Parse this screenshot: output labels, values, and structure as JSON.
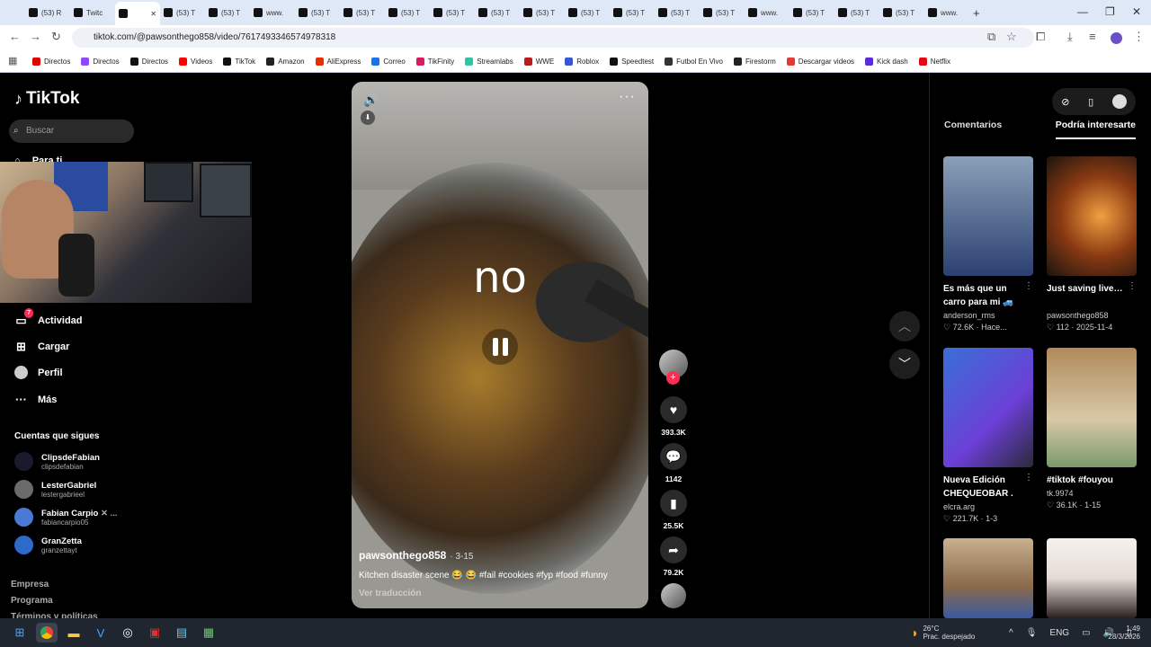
{
  "browser": {
    "tabs": [
      {
        "label": "(53) R",
        "active": false
      },
      {
        "label": "Twitc",
        "active": false
      },
      {
        "label": "",
        "active": true
      },
      {
        "label": "(53) T",
        "active": false
      },
      {
        "label": "(53) T",
        "active": false
      },
      {
        "label": "www.",
        "active": false
      },
      {
        "label": "(53) T",
        "active": false
      },
      {
        "label": "(53) T",
        "active": false
      },
      {
        "label": "(53) T",
        "active": false
      },
      {
        "label": "(53) T",
        "active": false
      },
      {
        "label": "(53) T",
        "active": false
      },
      {
        "label": "(53) T",
        "active": false
      },
      {
        "label": "(53) T",
        "active": false
      },
      {
        "label": "(53) T",
        "active": false
      },
      {
        "label": "(53) T",
        "active": false
      },
      {
        "label": "(53) T",
        "active": false
      },
      {
        "label": "www.",
        "active": false
      },
      {
        "label": "(53) T",
        "active": false
      },
      {
        "label": "(53) T",
        "active": false
      },
      {
        "label": "(53) T",
        "active": false
      },
      {
        "label": "www.",
        "active": false
      }
    ],
    "new_tab": "+",
    "url": "tiktok.com/@pawsonthego858/video/7617493346574978318",
    "bookmarks": [
      {
        "label": "Directos",
        "color": "#e00000"
      },
      {
        "label": "Directos",
        "color": "#9146ff"
      },
      {
        "label": "Directos",
        "color": "#111111"
      },
      {
        "label": "Videos",
        "color": "#ff0000"
      },
      {
        "label": "TikTok",
        "color": "#111111"
      },
      {
        "label": "Amazon",
        "color": "#222222"
      },
      {
        "label": "AliExpress",
        "color": "#e62e04"
      },
      {
        "label": "Correo",
        "color": "#1a73e8"
      },
      {
        "label": "TikFinity",
        "color": "#d81b60"
      },
      {
        "label": "Streamlabs",
        "color": "#31c3a2"
      },
      {
        "label": "WWE",
        "color": "#b71c1c"
      },
      {
        "label": "Roblox",
        "color": "#3955d1"
      },
      {
        "label": "Speedtest",
        "color": "#111111"
      },
      {
        "label": "Futbol En Vivo",
        "color": "#333333"
      },
      {
        "label": "Firestorm",
        "color": "#222222"
      },
      {
        "label": "Descargar videos",
        "color": "#e53935"
      },
      {
        "label": "Kick dash",
        "color": "#5b2bd9"
      },
      {
        "label": "Netflix",
        "color": "#e50914"
      }
    ]
  },
  "tiktok": {
    "logo": "TikTok",
    "search_placeholder": "Buscar",
    "nav_partial": "Para ti",
    "nav": [
      {
        "label": "Actividad",
        "icon": "activity-icon",
        "badge": "7"
      },
      {
        "label": "Cargar",
        "icon": "upload-icon"
      },
      {
        "label": "Perfil",
        "icon": "profile-icon"
      },
      {
        "label": "Más",
        "icon": "more-icon"
      }
    ],
    "following_title": "Cuentas que sigues",
    "following": [
      {
        "name": "ClipsdeFabian",
        "handle": "clipsdefabian"
      },
      {
        "name": "LesterGabriel",
        "handle": "lestergabrieel"
      },
      {
        "name": "Fabian Carpio",
        "handle": "fabiancarpio05",
        "suffix": "✕ ..."
      },
      {
        "name": "GranZetta",
        "handle": "granzettayt"
      }
    ],
    "footer": [
      "Empresa",
      "Programa",
      "Términos y políticas"
    ]
  },
  "video": {
    "overlay_text": "no",
    "username": "pawsonthego858",
    "date": "· 3-15",
    "description": "Kitchen disaster scene 😂 😂 #fail #cookies #fyp #food #funny",
    "translate": "Ver traducción",
    "likes": "393.3K",
    "comments": "1142",
    "saves": "25.5K",
    "shares": "79.2K"
  },
  "right_panel": {
    "tabs": [
      {
        "label": "Comentarios",
        "active": false
      },
      {
        "label": "Podría interesarte",
        "active": true
      }
    ],
    "cards": [
      {
        "title": "Es más que un carro para mi 🚙 ...",
        "user": "anderson_rms",
        "meta": "♡ 72.6K · Hace...",
        "thumb": "#2b4070"
      },
      {
        "title": "Just saving lives ❤️ ❤️ ...",
        "user": "pawsonthego858",
        "meta": "♡ 112 · 2025-11-4",
        "thumb": "#8a3a12"
      },
      {
        "title": "Nueva Edición CHEQUEOBAR . ...",
        "user": "elcra.arg",
        "meta": "♡ 221.7K · 1-3",
        "thumb": "#3a6fd6"
      },
      {
        "title": "#tiktok #fouyou",
        "user": "tk.9974",
        "meta": "♡ 36.1K · 1-15",
        "thumb": "#b08a5a"
      },
      {
        "title": "",
        "user": "",
        "meta": "",
        "thumb": "#8a6a4a"
      },
      {
        "title": "",
        "user": "",
        "meta": "",
        "thumb": "#e6dcd6"
      }
    ]
  },
  "taskbar": {
    "weather_temp": "26°C",
    "weather_desc": "Prac. despejado",
    "lang": "ENG",
    "time": "1:49",
    "date": "28/3/2026"
  }
}
